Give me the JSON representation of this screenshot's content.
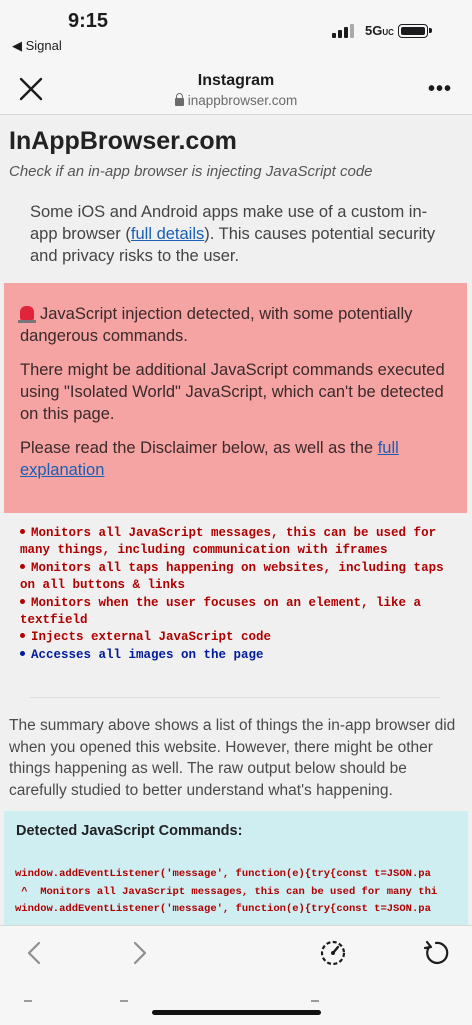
{
  "status_bar": {
    "time": "9:15",
    "back_label": "◀ Signal",
    "network": "5G",
    "network_sub": "UC"
  },
  "header": {
    "title": "Instagram",
    "url": "inappbrowser.com"
  },
  "page": {
    "site_title": "InAppBrowser.com",
    "tagline": "Check if an in-app browser is injecting JavaScript code",
    "intro": {
      "before": "Some iOS and Android apps make use of a custom in-app browser (",
      "link": "full details",
      "after": "). This causes potential security and privacy risks to the user."
    },
    "alert": {
      "line1": "JavaScript injection detected, with some potentially dangerous commands.",
      "line2": "There might be additional JavaScript commands executed using \"Isolated World\" JavaScript, which can't be detected on this page.",
      "line3_before": "Please read the Disclaimer below, as well as the ",
      "line3_link": "full explanation"
    },
    "findings": [
      "Monitors all JavaScript messages, this can be used for many things, including communication with iframes",
      "Monitors all taps happening on websites, including taps on all buttons & links",
      "Monitors when the user focuses on an element, like a textfield",
      "Injects external JavaScript code",
      "Accesses all images on the page"
    ],
    "summary": "The summary above shows a list of things the in-app browser did when you opened this website. However, there might be other things happening as well. The raw output below should be carefully studied to better understand what's happening.",
    "commands": {
      "heading": "Detected JavaScript Commands:",
      "line1": "window.addEventListener('message', function(e){try{const t=JSON.pa",
      "line2": " ^  Monitors all JavaScript messages, this can be used for many thi",
      "line3": "window.addEventListener('message', function(e){try{const t=JSON.pa"
    }
  },
  "colors": {
    "alert_bg": "#f5a3a3",
    "finding_red": "#b00000",
    "finding_blue": "#001a99",
    "commands_bg": "#cfeef2",
    "link": "#1a5fb4"
  },
  "icons": [
    "close-icon",
    "lock-icon",
    "more-icon",
    "siren-icon",
    "back-icon",
    "forward-icon",
    "speed-icon",
    "reload-icon"
  ]
}
